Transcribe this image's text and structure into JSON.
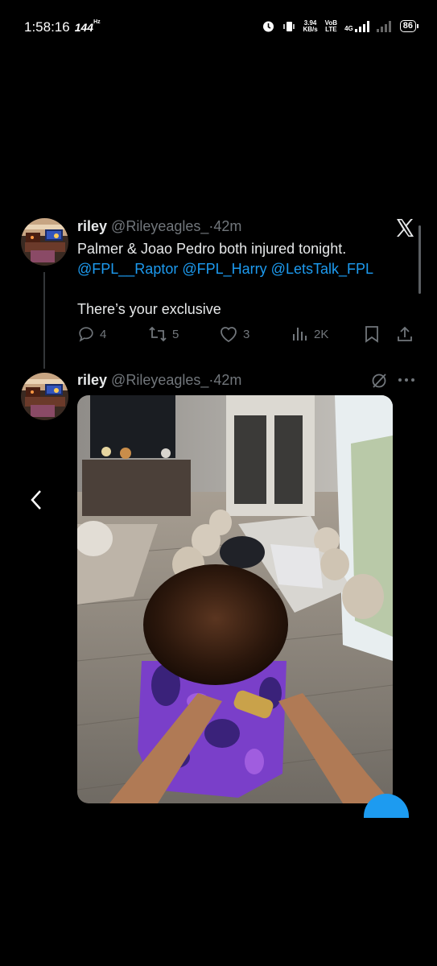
{
  "status_bar": {
    "time": "1:58:16",
    "refresh_rate": "144",
    "refresh_unit": "Hz",
    "net_speed": "3.94",
    "net_unit": "KB/s",
    "volte_top": "VoB",
    "volte_bottom": "LTE",
    "network": "4G",
    "battery": "86"
  },
  "tweet1": {
    "name": "riley",
    "handle": "@Rileyeagles_",
    "separator": "·",
    "time": "42m",
    "line1": "Palmer & Joao Pedro both injured tonight.",
    "mentions": [
      "@FPL__Raptor",
      "@FPL_Harry",
      "@LetsTalk_FPL"
    ],
    "line3": "There’s your exclusive",
    "replies": "4",
    "retweets": "5",
    "likes": "3",
    "views": "2K"
  },
  "tweet2": {
    "name": "riley",
    "handle": "@Rileyeagles_",
    "separator": "·",
    "time": "42m"
  },
  "icons": {
    "x_logo": "x-logo-icon",
    "reply": "reply-icon",
    "retweet": "retweet-icon",
    "like": "heart-icon",
    "views": "views-icon",
    "bookmark": "bookmark-icon",
    "share": "share-icon",
    "grok": "grok-icon",
    "more": "more-icon",
    "back": "chevron-left-icon"
  },
  "colors": {
    "background": "#000000",
    "text": "#e7e9ea",
    "muted": "#71767b",
    "accent": "#1d9bf0"
  }
}
